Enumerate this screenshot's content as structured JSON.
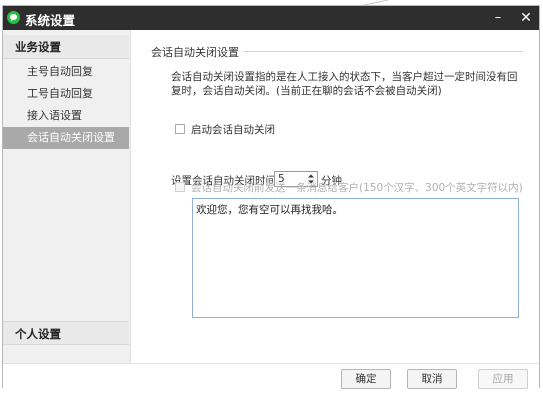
{
  "window": {
    "title": "系统设置",
    "minimize_label": "–",
    "close_label": "✕"
  },
  "sidebar": {
    "group_business": "业务设置",
    "items": [
      {
        "label": "主号自动回复",
        "active": false
      },
      {
        "label": "工号自动回复",
        "active": false
      },
      {
        "label": "接入语设置",
        "active": false
      },
      {
        "label": "会话自动关闭设置",
        "active": true
      }
    ],
    "group_personal": "个人设置"
  },
  "main": {
    "section_title": "会话自动关闭设置",
    "description": "会话自动关闭设置指的是在人工接入的状态下，当客户超过一定时间没有回复时，会话自动关闭。(当前正在聊的会话不会被自动关闭)",
    "enable_checkbox_label": "启动会话自动关闭",
    "enable_checked": false,
    "time_label": "设置会话自动关闭时间",
    "time_value": "5",
    "time_unit": "分钟",
    "send_message_checkbox_label": "会话自动关闭前发送一条消息给客户(150个汉字、300个英文字符以内)",
    "send_message_checked": false,
    "message_text": "欢迎您，您有空可以再找我哈。"
  },
  "footer": {
    "ok_label": "确定",
    "cancel_label": "取消",
    "apply_label": "应用"
  },
  "colors": {
    "titlebar": "#2e2e2e",
    "app_icon": "#25c044",
    "active_item": "#a9a9a9",
    "textarea_border": "#8fb1d6"
  },
  "icons": {
    "app": "wechat-bubble-icon",
    "minimize": "minimize-icon",
    "close": "close-icon",
    "stepper": "spin-arrows-icon"
  }
}
